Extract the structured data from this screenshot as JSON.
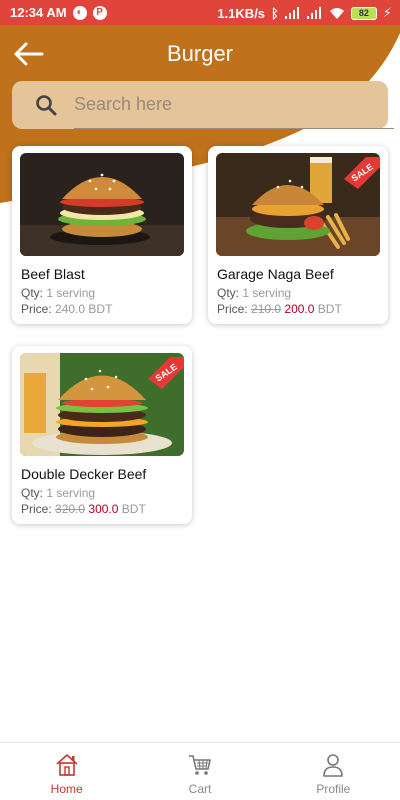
{
  "status_bar": {
    "time": "12:34 AM",
    "net_speed": "1.1KB/s",
    "battery": "82"
  },
  "header": {
    "title": "Burger",
    "background_color": "#bf721b",
    "back_icon": "arrow-left-icon"
  },
  "search": {
    "placeholder": "Search here",
    "value": ""
  },
  "products": [
    {
      "name": "Beef Blast",
      "qty_label": "Qty:",
      "qty_value": "1 serving",
      "price_label": "Price:",
      "price": "240.0",
      "currency": "BDT",
      "on_sale": false
    },
    {
      "name": "Garage Naga Beef",
      "qty_label": "Qty:",
      "qty_value": "1 serving",
      "price_label": "Price:",
      "old_price": "210.0",
      "price": "200.0",
      "currency": "BDT",
      "on_sale": true,
      "sale_badge": "SALE"
    },
    {
      "name": "Double Decker Beef",
      "qty_label": "Qty:",
      "qty_value": "1 serving",
      "price_label": "Price:",
      "old_price": "320.0",
      "price": "300.0",
      "currency": "BDT",
      "on_sale": true,
      "sale_badge": "SALE"
    }
  ],
  "bottom_nav": [
    {
      "label": "Home",
      "icon": "home-icon",
      "active": true
    },
    {
      "label": "Cart",
      "icon": "cart-icon",
      "active": false
    },
    {
      "label": "Profile",
      "icon": "profile-icon",
      "active": false
    }
  ],
  "colors": {
    "status_bar": "#e0453b",
    "accent": "#bf721b",
    "search_bg": "#e6c49a",
    "sale_price": "#b00020",
    "active_nav": "#c0392b"
  }
}
